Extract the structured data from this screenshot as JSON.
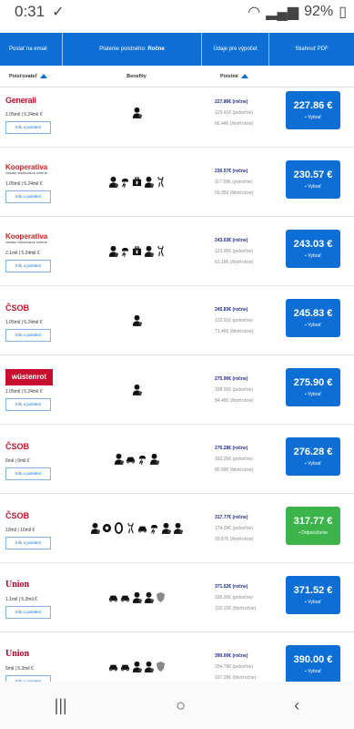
{
  "status": {
    "time": "0:31",
    "battery": "92%"
  },
  "topbar": {
    "email": "Poslať na email",
    "payment_label": "Platenie poistného:",
    "payment_value": "Ročne",
    "details": "Údaje pre výpočet",
    "pdf": "Stiahnuť PDF"
  },
  "columns": {
    "insurer": "Poisťovateľ",
    "benefits": "Benefity",
    "premium": "Poistné"
  },
  "info_label": "Info o poistení",
  "buy_label": "Vybrať",
  "recommended_label": "Odporúčame",
  "rows": [
    {
      "logo": "Generali",
      "logo_style": "generali",
      "limit": "1.05mil | 5.24mil €",
      "p1": "227.86€ (ročne)",
      "p2": "123.41€ (polročne)",
      "p3": "66.44€ (štvrťročne)",
      "price": "227.86 €",
      "icons": [
        "person"
      ]
    },
    {
      "logo": "Kooperativa",
      "logo_sub": "VIENNA INSURANCE GROUP",
      "logo_style": "koop",
      "limit": "1.05mil | 5.24mil €",
      "p1": "230.57€ (ročne)",
      "p2": "117.59€ (polročne)",
      "p3": "59.95€ (štvrťročne)",
      "price": "230.57 €",
      "icons": [
        "person",
        "storm",
        "case",
        "person",
        "deer"
      ]
    },
    {
      "logo": "Kooperativa",
      "logo_sub": "VIENNA INSURANCE GROUP",
      "logo_style": "koop",
      "limit": "2.1mil | 5.24mil €",
      "p1": "243.03€ (ročne)",
      "p2": "123.95€ (polročne)",
      "p3": "63.19€ (štvrťročne)",
      "price": "243.03 €",
      "icons": [
        "person",
        "storm",
        "case",
        "person",
        "deer"
      ]
    },
    {
      "logo": "ČSOB",
      "logo_style": "csob",
      "limit": "1.05mil | 5.24mil €",
      "p1": "245.83€ (ročne)",
      "p2": "132.91€ (polročne)",
      "p3": "71.46€ (štvrťročne)",
      "price": "245.83 €",
      "icons": [
        "person"
      ]
    },
    {
      "logo": "wüstenrot",
      "logo_style": "wust",
      "limit": "1.05mil | 5.24mil €",
      "p1": "275.90€ (ročne)",
      "p2": "168.95€ (polročne)",
      "p3": "84.48€ (štvrťročne)",
      "price": "275.90 €",
      "icons": [
        "person"
      ]
    },
    {
      "logo": "ČSOB",
      "logo_style": "csob",
      "limit": "6mil | 6mil €",
      "p1": "276.28€ (ročne)",
      "p2": "150.26€ (polročne)",
      "p3": "80.89€ (štvrťročne)",
      "price": "276.28 €",
      "icons": [
        "person",
        "car",
        "storm",
        "person"
      ]
    },
    {
      "logo": "ČSOB",
      "logo_style": "csob",
      "limit": "10mil | 10mil €",
      "p1": "317.77€ (ročne)",
      "p2": "174.39€ (polročne)",
      "p3": "93.87€ (štvrťročne)",
      "price": "317.77 €",
      "icons": [
        "person",
        "wheel",
        "tire",
        "deer",
        "car",
        "storm",
        "person",
        "person"
      ],
      "recommended": true
    },
    {
      "logo": "Union",
      "logo_style": "union",
      "limit": "1.1mil | 5.3mil €",
      "p1": "371.52€ (ročne)",
      "p2": "195.00€ (polročne)",
      "p3": "102.15€ (štvrťročne)",
      "price": "371.52 €",
      "icons": [
        "car",
        "car",
        "person",
        "person",
        "shield"
      ]
    },
    {
      "logo": "Union",
      "logo_style": "union",
      "limit": "5mil | 5.3mil €",
      "p1": "390.00€ (ročne)",
      "p2": "204.78€ (polročne)",
      "p3": "107.28€ (štvrťročne)",
      "price": "390.00 €",
      "icons": [
        "car",
        "car",
        "person",
        "person",
        "shield"
      ]
    }
  ]
}
